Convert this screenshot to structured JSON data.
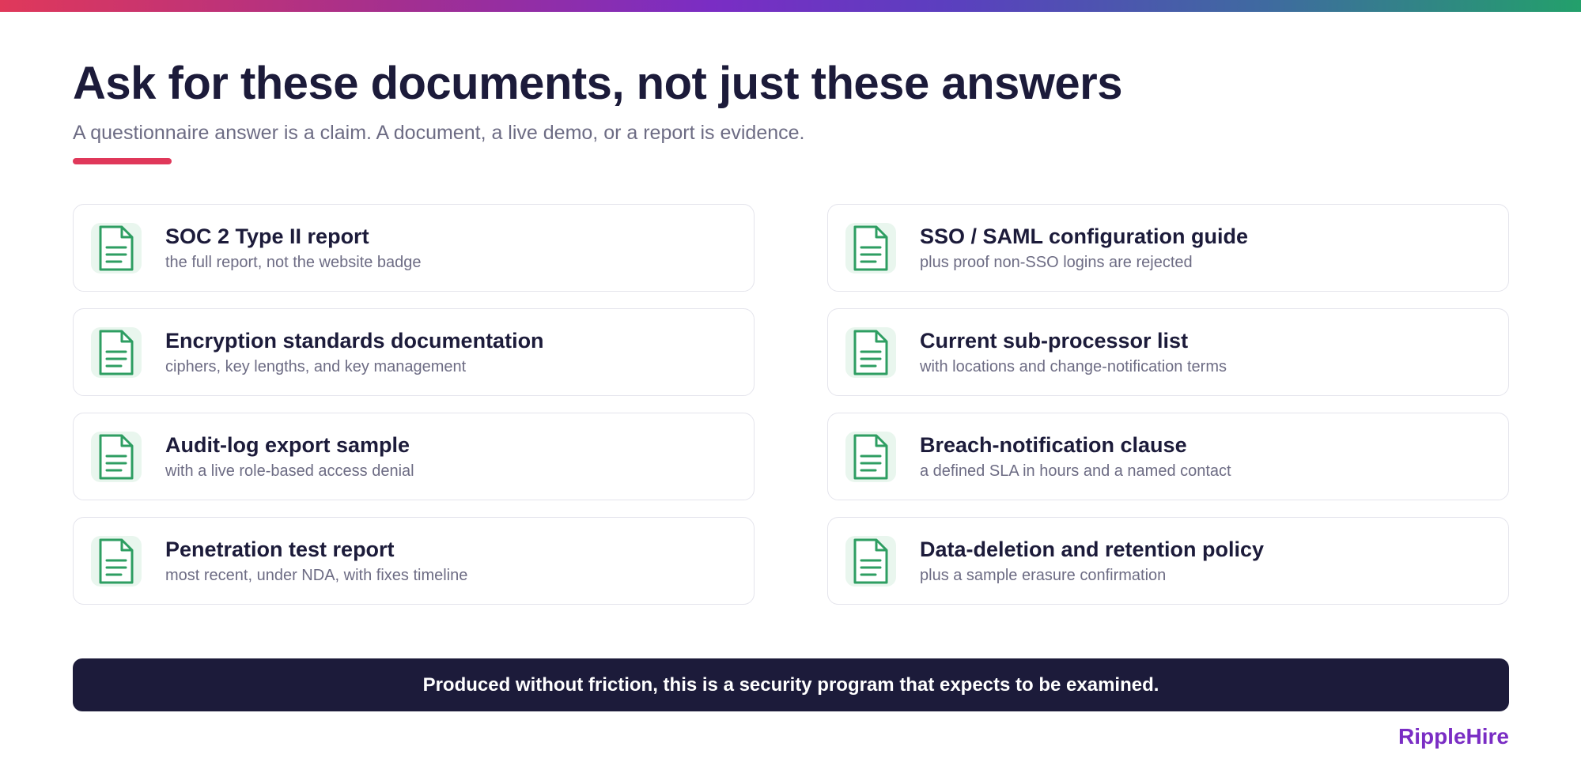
{
  "title": "Ask for these documents, not just these answers",
  "subtitle": "A questionnaire answer is a claim. A document, a live demo, or a report is evidence.",
  "colors": {
    "accent_red": "#e0385a",
    "navy": "#1c1b3a",
    "icon_green": "#2e9e62",
    "icon_tile": "#e9f6ee",
    "brand_purple": "#7a2dc4"
  },
  "icon": "document-icon",
  "documents": [
    {
      "title": "SOC 2 Type II report",
      "description": "the full report, not the website badge"
    },
    {
      "title": "SSO / SAML configuration guide",
      "description": "plus proof non-SSO logins are rejected"
    },
    {
      "title": "Encryption standards documentation",
      "description": "ciphers, key lengths, and key management"
    },
    {
      "title": "Current sub-processor list",
      "description": "with locations and change-notification terms"
    },
    {
      "title": "Audit-log export sample",
      "description": "with a live role-based access denial"
    },
    {
      "title": "Breach-notification clause",
      "description": "a defined SLA in hours and a named contact"
    },
    {
      "title": "Penetration test report",
      "description": "most recent, under NDA, with fixes timeline"
    },
    {
      "title": "Data-deletion and retention policy",
      "description": "plus a sample erasure confirmation"
    }
  ],
  "banner": "Produced without friction, this is a security program that expects to be examined.",
  "brand": "RippleHire"
}
